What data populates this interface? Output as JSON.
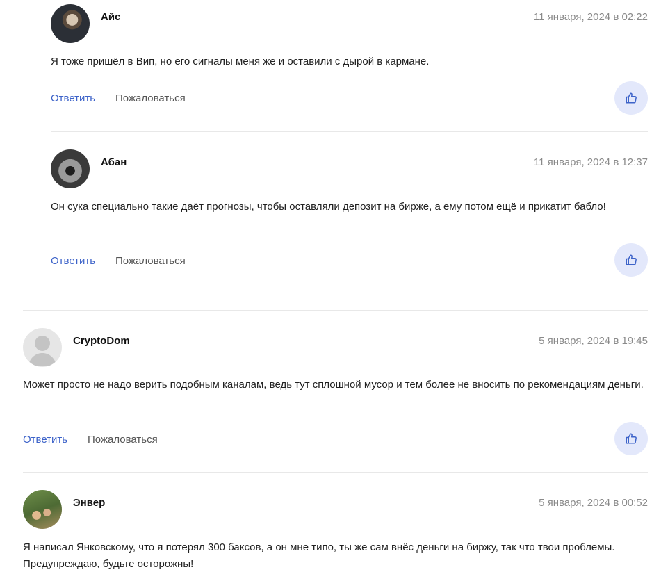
{
  "comments": [
    {
      "author": "Айс",
      "date": "11 января, 2024 в 02:22",
      "text": "Я тоже пришёл в Вип, но его сигналы меня же и оставили с дырой в кармане.",
      "reply_label": "Ответить",
      "report_label": "Пожаловаться",
      "avatar": "photo"
    },
    {
      "author": "Абан",
      "date": "11 января, 2024 в 12:37",
      "text": "Он сука специально такие даёт прогнозы, чтобы оставляли депозит на бирже, а ему потом ещё и прикатит бабло!",
      "reply_label": "Ответить",
      "report_label": "Пожаловаться",
      "avatar": "photo"
    },
    {
      "author": "CryptoDom",
      "date": "5 января, 2024 в 19:45",
      "text": "Может просто не надо верить подобным каналам, ведь тут сплошной мусор и тем более не вносить по рекомендациям деньги.",
      "reply_label": "Ответить",
      "report_label": "Пожаловаться",
      "avatar": "default-user"
    },
    {
      "author": "Энвер",
      "date": "5 января, 2024 в 00:52",
      "text": "Я написал Янковскому, что я потерял 300 баксов, а он мне типо, ты же сам внёс деньги на биржу, так что твои проблемы. Предупреждаю, будьте осторожны!",
      "avatar": "photo"
    }
  ],
  "colors": {
    "accent": "#3d63c9",
    "like_bg": "#e3e8fb",
    "date": "#8a8a8a",
    "divider": "#e8e8e8"
  },
  "icons": {
    "like": "thumbs-up-icon"
  }
}
